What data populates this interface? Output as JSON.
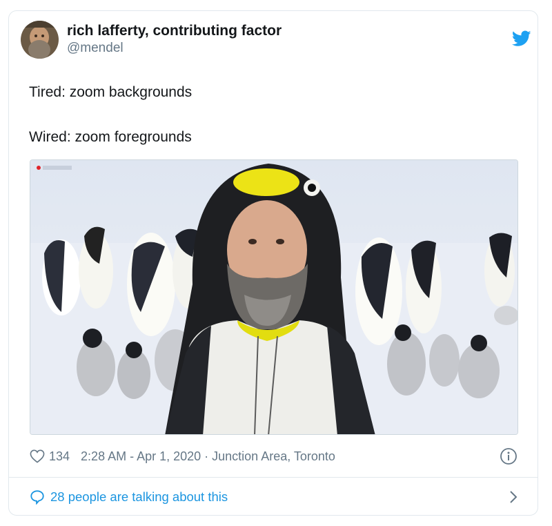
{
  "tweet": {
    "display_name": "rich lafferty, contributing factor",
    "handle": "@mendel",
    "lines": [
      "Tired: zoom backgrounds",
      "Wired: zoom foregrounds"
    ],
    "likes": "134",
    "timestamp": "2:28 AM - Apr 1, 2020 · Junction Area, Toronto",
    "conversation_label": "28 people are talking about this"
  },
  "colors": {
    "brand": "#1da1f2",
    "link": "#1b95e0",
    "muted": "#657786",
    "text": "#14171a",
    "border": "#e1e8ed"
  },
  "icons": {
    "brand": "twitter-bird-icon",
    "like": "heart-icon",
    "info": "info-icon",
    "reply": "speech-bubble-icon",
    "open": "chevron-right-icon"
  }
}
